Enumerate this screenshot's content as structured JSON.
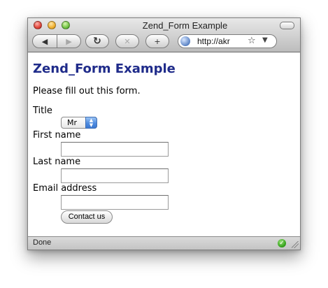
{
  "window": {
    "title": "Zend_Form Example",
    "status": "Done"
  },
  "toolbar": {
    "back_icon": "◀",
    "forward_icon": "▶",
    "reload_icon": "↻",
    "stop_icon": "✕",
    "addbookmark_icon": "+",
    "url": "http://akr",
    "star_icon": "☆",
    "dropdown_icon": "▼"
  },
  "page": {
    "heading": "Zend_Form Example",
    "intro": "Please fill out this form.",
    "form": {
      "title_label": "Title",
      "title_value": "Mr",
      "first_name_label": "First name",
      "first_name_value": "",
      "last_name_label": "Last name",
      "last_name_value": "",
      "email_label": "Email address",
      "email_value": "",
      "submit_label": "Contact us"
    }
  },
  "colors": {
    "heading": "#1f2b8a",
    "select_accent": "#4f8ce0",
    "status_ok": "#31a018"
  }
}
